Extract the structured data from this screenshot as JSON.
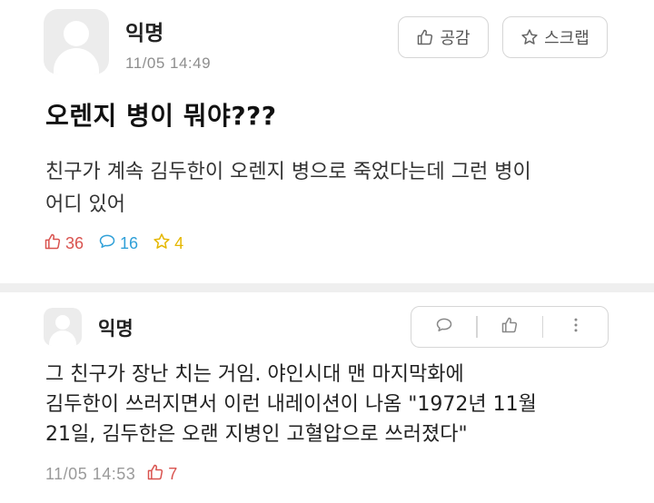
{
  "post": {
    "author": "익명",
    "time": "11/05 14:49",
    "like_button_label": "공감",
    "scrap_button_label": "스크랩",
    "title": "오렌지 병이 뭐야???",
    "body_line1": "친구가 계속 김두한이 오렌지 병으로 죽었다는데 그런 병이",
    "body_line2": "어디 있어",
    "like_count": "36",
    "comment_count": "16",
    "scrap_count": "4"
  },
  "comment": {
    "author": "익명",
    "body_line1": "그 친구가 장난 치는 거임. 야인시대 맨 마지막화에",
    "body_line2": "김두한이 쓰러지면서 이런 내레이션이 나옴 \"1972년 11월",
    "body_line3": "21일, 김두한은 오랜 지병인 고혈압으로 쓰러졌다\"",
    "time": "11/05 14:53",
    "like_count": "7"
  },
  "icons": {
    "like": "thumbs-up-icon",
    "scrap": "star-icon",
    "comment": "speech-bubble-icon",
    "more": "vertical-dots-icon"
  },
  "colors": {
    "like": "#d9534f",
    "comment": "#30a0d8",
    "scrap": "#e5b700",
    "meta_text": "#8e8e8e"
  }
}
